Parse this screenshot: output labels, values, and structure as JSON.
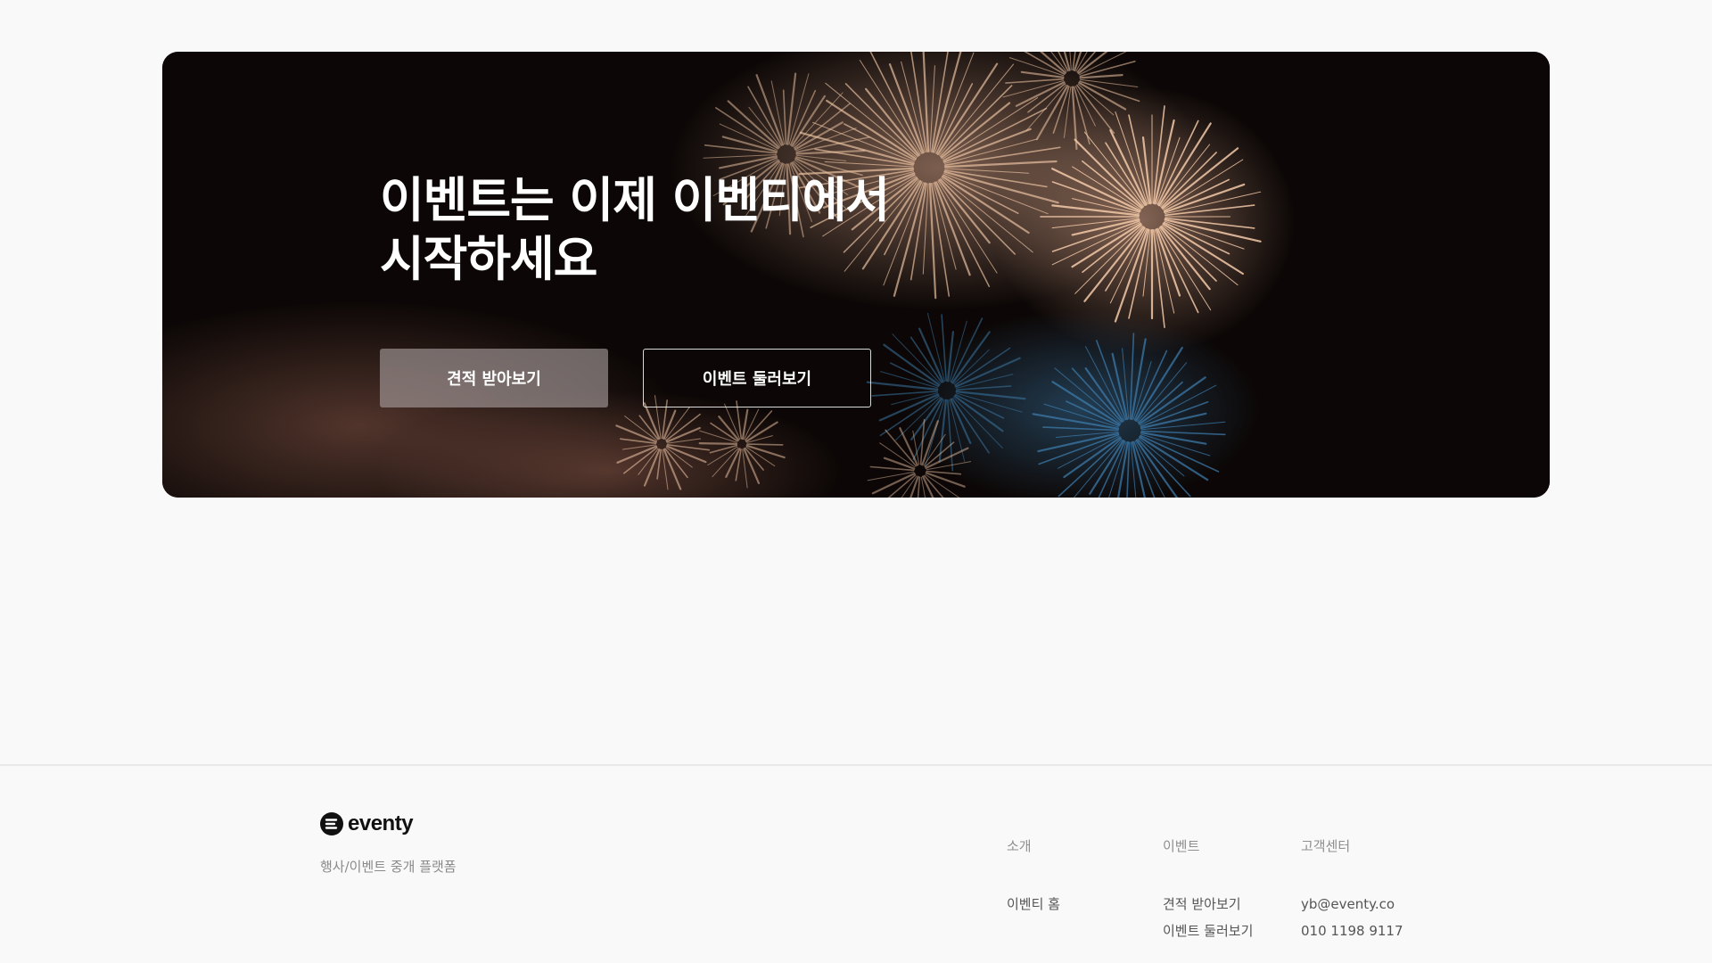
{
  "hero": {
    "title_line1": "이벤트는 이제 이벤티에서",
    "title_line2": "시작하세요",
    "quote_button": "견적 받아보기",
    "browse_button": "이벤트 둘러보기",
    "background_icon": "fireworks-image"
  },
  "footer": {
    "logo_text": "eventy",
    "tagline": "행사/이벤트 중개 플랫폼",
    "columns": [
      {
        "heading": "소개",
        "links": [
          "이벤티 홈"
        ]
      },
      {
        "heading": "이벤트",
        "links": [
          "견적 받아보기",
          "이벤트 둘러보기"
        ]
      },
      {
        "heading": "고객센터",
        "links": [
          "yb@eventy.co",
          "010 1198 9117"
        ]
      }
    ]
  },
  "colors": {
    "page_bg": "#f9f9f9",
    "hero_bg": "#0c0706",
    "firework_warm": "#f3c9a8",
    "firework_blue": "#3e7fb0"
  }
}
